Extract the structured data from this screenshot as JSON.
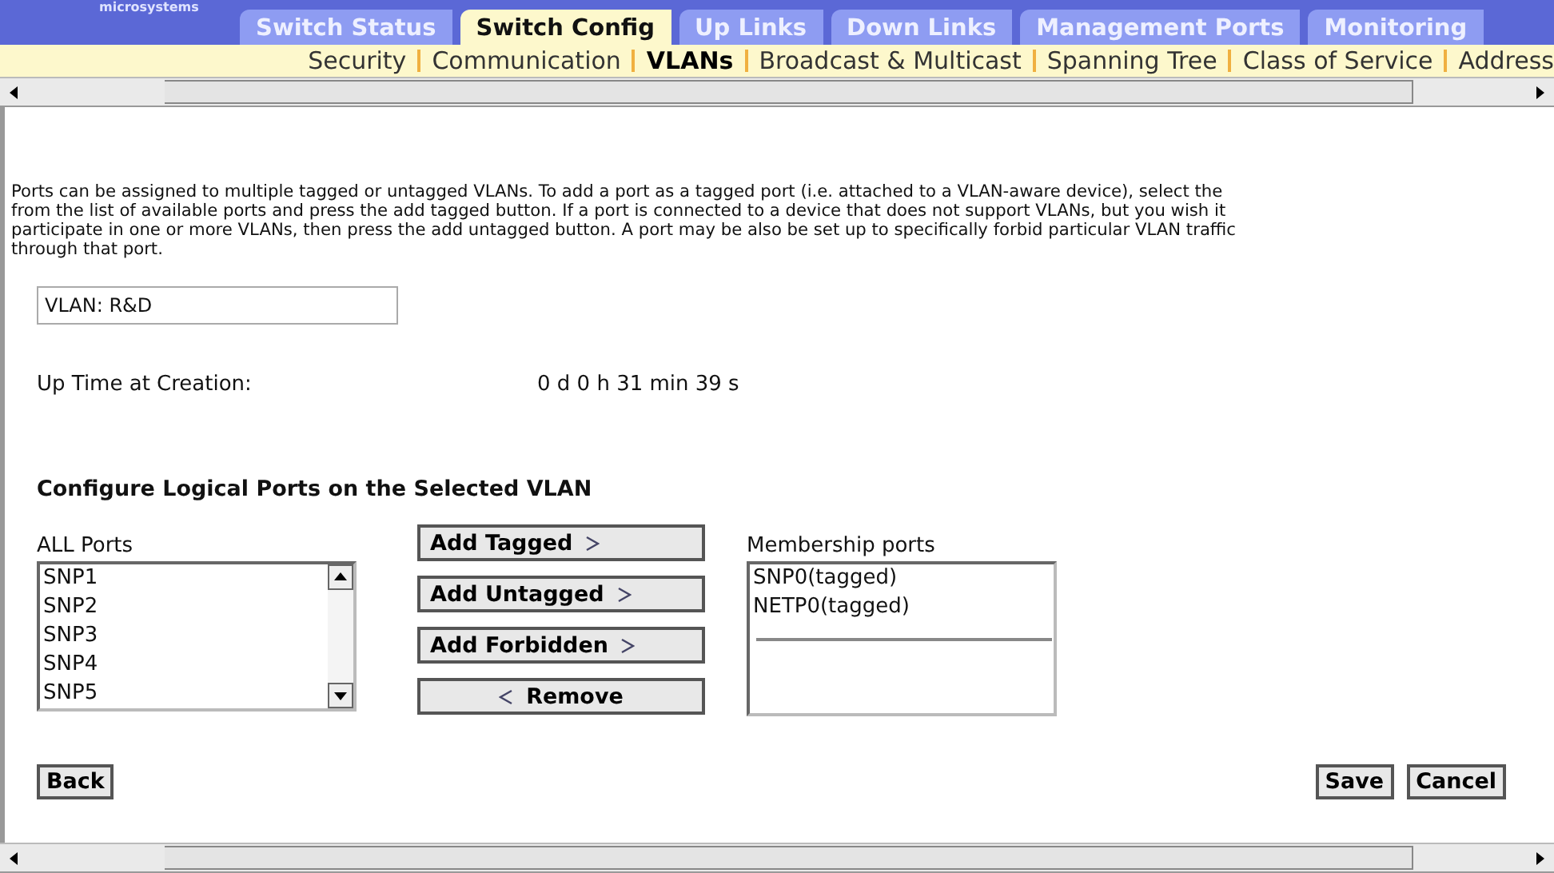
{
  "logo": {
    "text": "microsystems"
  },
  "tabs": [
    {
      "label": "Switch Status",
      "selected": false
    },
    {
      "label": "Switch Config",
      "selected": true
    },
    {
      "label": "Up Links",
      "selected": false
    },
    {
      "label": "Down Links",
      "selected": false
    },
    {
      "label": "Management Ports",
      "selected": false
    },
    {
      "label": "Monitoring",
      "selected": false
    }
  ],
  "subnav": [
    {
      "label": "Security",
      "selected": false
    },
    {
      "label": "Communication",
      "selected": false
    },
    {
      "label": "VLANs",
      "selected": true
    },
    {
      "label": "Broadcast & Multicast",
      "selected": false
    },
    {
      "label": "Spanning Tree",
      "selected": false
    },
    {
      "label": "Class of Service",
      "selected": false
    },
    {
      "label": "Address",
      "selected": false
    }
  ],
  "description": [
    "Ports can be assigned to multiple tagged or untagged VLANs. To add a port as a tagged port (i.e. attached to a VLAN-aware device), select the",
    "from the list of available ports and press the add tagged button. If a port is connected to a device that does not support VLANs, but you wish it",
    "participate in one or more VLANs, then press the add untagged button. A port may be also be set up to specifically forbid particular VLAN traffic",
    "through that port."
  ],
  "vlan_field": {
    "value": "VLAN: R&D"
  },
  "uptime": {
    "label": "Up Time at Creation:",
    "value": "0 d 0 h 31 min 39 s"
  },
  "section_title": "Configure Logical Ports on the Selected VLAN",
  "all_ports": {
    "label": "ALL Ports",
    "items": [
      "SNP1",
      "SNP2",
      "SNP3",
      "SNP4",
      "SNP5"
    ]
  },
  "actions": [
    {
      "label": "Add Tagged",
      "kind": "add"
    },
    {
      "label": "Add Untagged",
      "kind": "add"
    },
    {
      "label": "Add Forbidden",
      "kind": "add"
    },
    {
      "label": "Remove",
      "kind": "remove"
    }
  ],
  "membership": {
    "label": "Membership ports",
    "items": [
      "SNP0(tagged)",
      "NETP0(tagged)"
    ]
  },
  "footer_buttons": {
    "back": "Back",
    "save": "Save",
    "cancel": "Cancel"
  }
}
